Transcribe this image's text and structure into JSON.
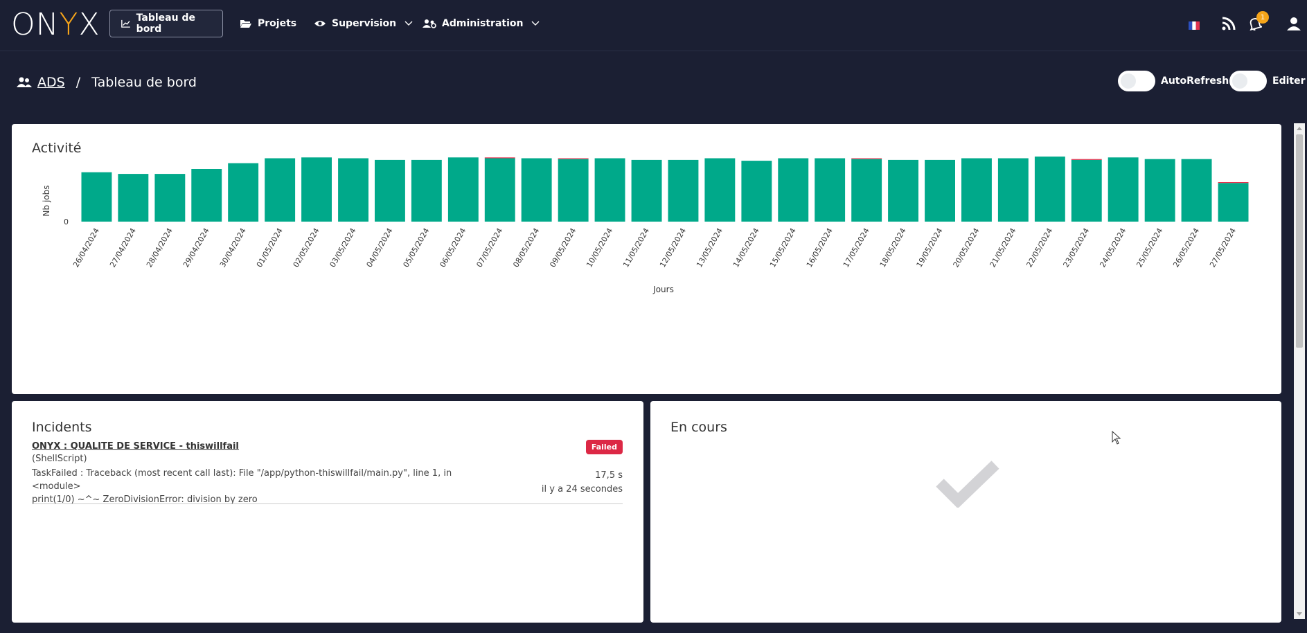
{
  "app": {
    "logo_text_left": "ON",
    "logo_text_y": "Y",
    "logo_text_right": "X"
  },
  "nav": {
    "items": [
      {
        "label": "Tableau de bord",
        "icon": "chart-line-icon"
      },
      {
        "label": "Projets",
        "icon": "folder-open-icon"
      },
      {
        "label": "Supervision",
        "icon": "eye-icon"
      },
      {
        "label": "Administration",
        "icon": "users-cog-icon"
      }
    ],
    "notification_count": "1",
    "colors": {
      "accent": "#f6a51a",
      "bg": "#1b1f33"
    }
  },
  "breadcrumb": {
    "team": "ADS",
    "separator": "/",
    "page": "Tableau de bord"
  },
  "toggles": {
    "autorefresh_label": "AutoRefresh",
    "editer_label": "Editer"
  },
  "activity": {
    "title": "Activité"
  },
  "chart_data": {
    "type": "bar",
    "title": "Activité",
    "xlabel": "Jours",
    "ylabel": "Nb jobs",
    "ytick_labels": [
      "0"
    ],
    "categories": [
      "26/04/2024",
      "27/04/2024",
      "28/04/2024",
      "29/04/2024",
      "30/04/2024",
      "01/05/2024",
      "02/05/2024",
      "03/05/2024",
      "04/05/2024",
      "05/05/2024",
      "06/05/2024",
      "07/05/2024",
      "08/05/2024",
      "09/05/2024",
      "10/05/2024",
      "11/05/2024",
      "12/05/2024",
      "13/05/2024",
      "14/05/2024",
      "15/05/2024",
      "16/05/2024",
      "17/05/2024",
      "18/05/2024",
      "19/05/2024",
      "20/05/2024",
      "21/05/2024",
      "22/05/2024",
      "23/05/2024",
      "24/05/2024",
      "25/05/2024",
      "26/05/2024",
      "27/05/2024"
    ],
    "series": [
      {
        "color": "#00a98a",
        "values": [
          60,
          58,
          58,
          64,
          71,
          77,
          78,
          77,
          75,
          75,
          78,
          77,
          77,
          76,
          77,
          75,
          75,
          77,
          74,
          77,
          77,
          76,
          75,
          75,
          77,
          77,
          79,
          75,
          78,
          76,
          76,
          47
        ]
      },
      {
        "color": "#e0344f",
        "values": [
          0,
          0,
          0,
          0,
          0,
          0,
          0,
          0,
          0,
          0,
          0,
          1,
          0,
          1,
          0,
          0,
          0,
          0,
          0,
          0,
          0,
          1,
          0,
          0,
          0,
          0,
          0,
          1,
          0,
          0,
          0,
          1
        ]
      }
    ],
    "ylim": [
      0,
      85
    ],
    "grid": false
  },
  "incidents": {
    "title": "Incidents",
    "items": [
      {
        "name": "ONYX : QUALITE DE SERVICE - thiswillfail",
        "type": "(ShellScript)",
        "message_line1": "TaskFailed : Traceback (most recent call last): File \"/app/python-thiswillfail/main.py\", line 1, in <module>",
        "message_line2": "print(1/0) ~^~ ZeroDivisionError: division by zero",
        "status": "Failed",
        "duration": "17,5 s",
        "ago": "il y a 24 secondes",
        "status_color": "#dc2845"
      }
    ]
  },
  "en_cours": {
    "title": "En cours",
    "empty_icon": "check-icon"
  }
}
